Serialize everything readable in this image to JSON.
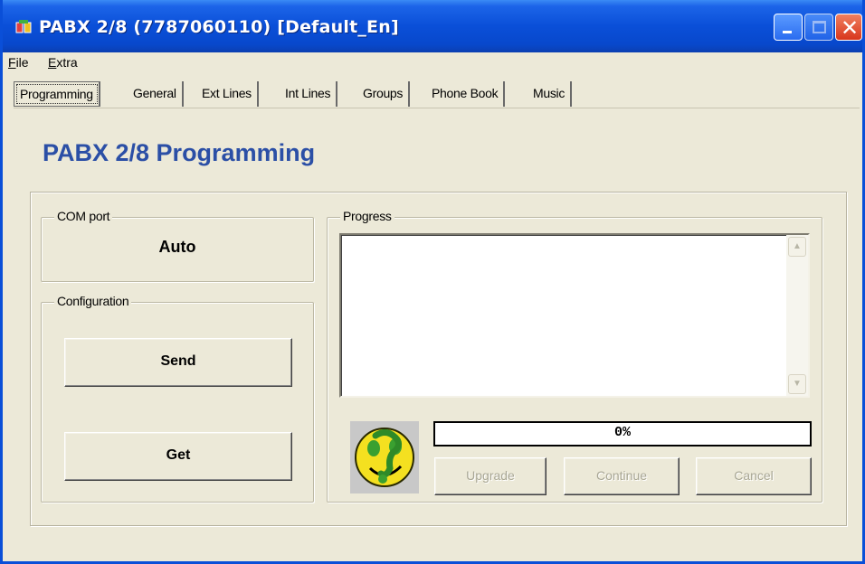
{
  "window": {
    "title": "PABX 2/8 (7787060110) [Default_En]",
    "close_glyph": "✕",
    "colors": {
      "titlebar": "#0a4fd8",
      "face": "#ece9d8",
      "heading": "#2b4fa6"
    }
  },
  "menu": {
    "file": {
      "accel": "F",
      "rest": "ile"
    },
    "extra": {
      "accel": "E",
      "rest": "xtra"
    }
  },
  "tabs": [
    "Programming",
    "General",
    "Ext Lines",
    "Int Lines",
    "Groups",
    "Phone Book",
    "Music"
  ],
  "page": {
    "heading": "PABX 2/8 Programming"
  },
  "com_port": {
    "label": "COM port",
    "value": "Auto"
  },
  "configuration": {
    "label": "Configuration",
    "send": "Send",
    "get": "Get"
  },
  "progress": {
    "label": "Progress",
    "log_text": "",
    "percent_text": "0%",
    "fraction": 0,
    "upgrade": "Upgrade",
    "continue": "Continue",
    "cancel": "Cancel"
  },
  "icons": {
    "app": "pabx-app-icon",
    "status": "smiley-face-icon",
    "scroll_up": "scroll-up-arrow-icon",
    "scroll_down": "scroll-down-arrow-icon"
  }
}
